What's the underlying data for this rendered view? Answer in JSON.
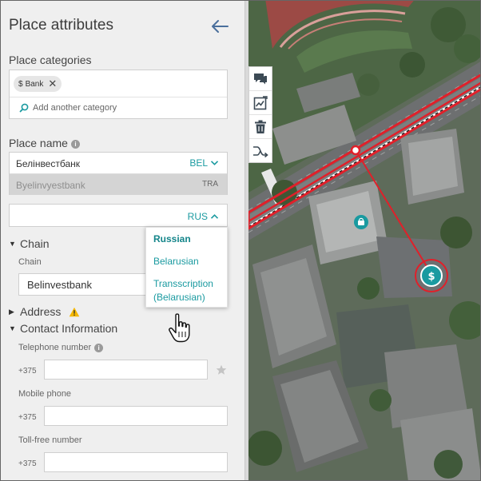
{
  "panel": {
    "title": "Place attributes",
    "categories": {
      "label": "Place categories",
      "chip_label": "Bank",
      "chip_symbol": "$",
      "add_placeholder": "Add another category"
    },
    "place_name": {
      "label": "Place name",
      "primary_value": "Белінвестбанк",
      "primary_lang": "BEL",
      "translit_value": "Byelinvyestbank",
      "translit_tag": "TRA",
      "new_lang": "RUS",
      "dropdown_options": [
        "Russian",
        "Belarusian",
        "Transscription (Belarusian)"
      ]
    },
    "chain": {
      "section": "Chain",
      "field_label": "Chain",
      "value": "Belinvestbank"
    },
    "address": {
      "section": "Address"
    },
    "contact": {
      "section": "Contact Information",
      "telephone_label": "Telephone number",
      "mobile_label": "Mobile phone",
      "tollfree_label": "Toll-free number",
      "prefix": "+375"
    }
  },
  "toolbar": {
    "icons": [
      "comment-icon",
      "chart-edit-icon",
      "trash-icon",
      "route-icon"
    ]
  },
  "map": {
    "accent": "#1a9aa0",
    "link_color": "#e0202a",
    "marker_icon": "bank-marker-icon",
    "poi_icon": "shopping-bag-icon"
  },
  "colors": {
    "panel_bg": "#efefef",
    "teal": "#1a9aa0",
    "warning": "#f5b800"
  }
}
